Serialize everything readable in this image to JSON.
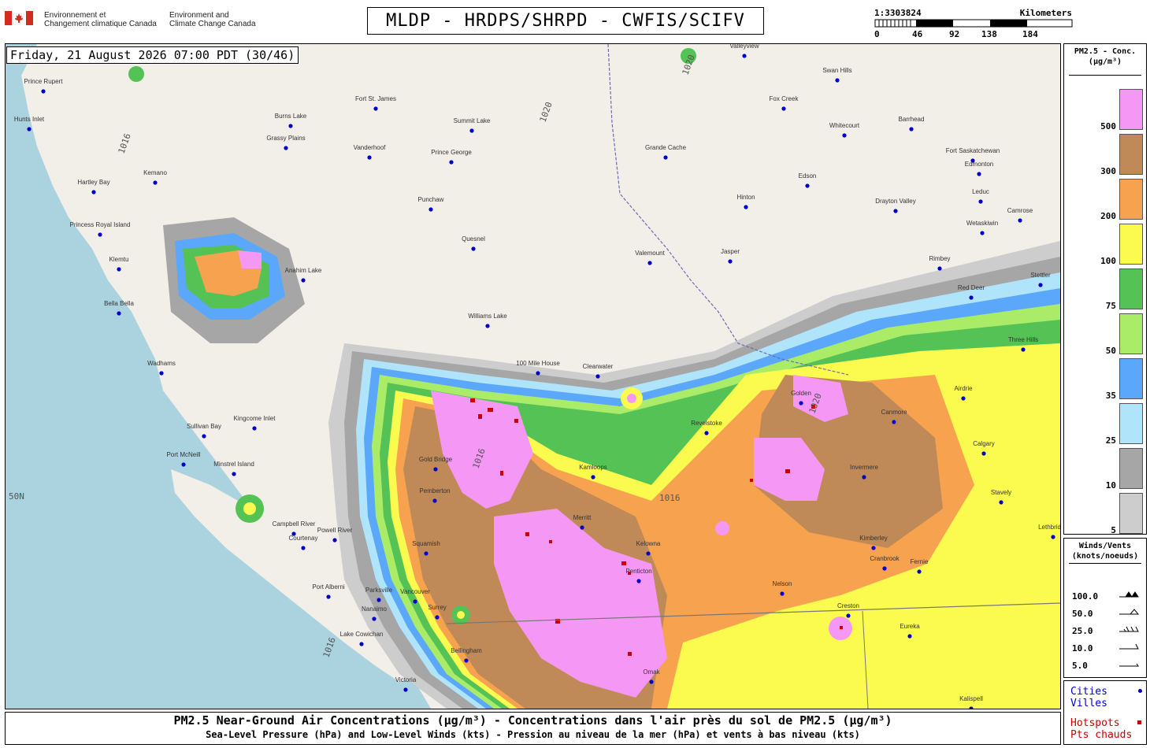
{
  "header": {
    "org_fr_line1": "Environnement et",
    "org_fr_line2": "Changement climatique Canada",
    "org_en_line1": "Environment and",
    "org_en_line2": "Climate Change Canada",
    "title": "MLDP - HRDPS/SHRPD - CWFIS/SCIFV"
  },
  "scale_bar": {
    "ratio": "1:3303824",
    "unit": "Kilometers",
    "ticks": [
      "0",
      "46",
      "92",
      "138",
      "184"
    ]
  },
  "map": {
    "timestamp": "Friday, 21 August 2026 07:00 PDT (30/46)",
    "latitude_label": "50N",
    "isobar_labels": [
      "1016",
      "1020"
    ],
    "cities": [
      {
        "name": "Prince Rupert"
      },
      {
        "name": "Hunts Inlet"
      },
      {
        "name": "Fort St. James"
      },
      {
        "name": "Burns Lake"
      },
      {
        "name": "Grassy Plains"
      },
      {
        "name": "Vanderhoof"
      },
      {
        "name": "Summit Lake"
      },
      {
        "name": "Prince George"
      },
      {
        "name": "Kemano"
      },
      {
        "name": "Hartley Bay"
      },
      {
        "name": "Princess Royal Island"
      },
      {
        "name": "Klemtu"
      },
      {
        "name": "Bella Bella"
      },
      {
        "name": "Anahim Lake"
      },
      {
        "name": "Punchaw"
      },
      {
        "name": "Quesnel"
      },
      {
        "name": "Williams Lake"
      },
      {
        "name": "100 Mile House"
      },
      {
        "name": "Wadhams"
      },
      {
        "name": "Kingcome Inlet"
      },
      {
        "name": "Sullivan Bay"
      },
      {
        "name": "Port McNeill"
      },
      {
        "name": "Minstrel Island"
      },
      {
        "name": "Campbell River"
      },
      {
        "name": "Powell River"
      },
      {
        "name": "Courtenay"
      },
      {
        "name": "Port Alberni"
      },
      {
        "name": "Parksville"
      },
      {
        "name": "Nanaimo"
      },
      {
        "name": "Lake Cowichan"
      },
      {
        "name": "Victoria"
      },
      {
        "name": "Vancouver"
      },
      {
        "name": "Surrey"
      },
      {
        "name": "Bellingham"
      },
      {
        "name": "Squamish"
      },
      {
        "name": "Gold Bridge"
      },
      {
        "name": "Pemberton"
      },
      {
        "name": "Kamloops"
      },
      {
        "name": "Clearwater"
      },
      {
        "name": "Merritt"
      },
      {
        "name": "Kelowna"
      },
      {
        "name": "Penticton"
      },
      {
        "name": "Omak"
      },
      {
        "name": "Grande Cache"
      },
      {
        "name": "Valemount"
      },
      {
        "name": "Jasper"
      },
      {
        "name": "Hinton"
      },
      {
        "name": "Edson"
      },
      {
        "name": "Whitecourt"
      },
      {
        "name": "Fox Creek"
      },
      {
        "name": "Swan Hills"
      },
      {
        "name": "Valleyview"
      },
      {
        "name": "Barrhead"
      },
      {
        "name": "Fort Saskatchewan"
      },
      {
        "name": "Edmonton"
      },
      {
        "name": "Leduc"
      },
      {
        "name": "Drayton Valley"
      },
      {
        "name": "Wetaskiwin"
      },
      {
        "name": "Camrose"
      },
      {
        "name": "Rimbey"
      },
      {
        "name": "Red Deer"
      },
      {
        "name": "Stettler"
      },
      {
        "name": "Three Hills"
      },
      {
        "name": "Airdrie"
      },
      {
        "name": "Calgary"
      },
      {
        "name": "Canmore"
      },
      {
        "name": "Golden"
      },
      {
        "name": "Revelstoke"
      },
      {
        "name": "Invermere"
      },
      {
        "name": "Kimberley"
      },
      {
        "name": "Cranbrook"
      },
      {
        "name": "Fernie"
      },
      {
        "name": "Nelson"
      },
      {
        "name": "Creston"
      },
      {
        "name": "Eureka"
      },
      {
        "name": "Kalispell"
      },
      {
        "name": "Stavely"
      },
      {
        "name": "Lethbridge"
      }
    ]
  },
  "legend": {
    "title_line1": "PM2.5 - Conc.",
    "title_line2": "(µg/m³)",
    "levels": [
      {
        "label": "500",
        "color": "#f598f5"
      },
      {
        "label": "300",
        "color": "#c08a58"
      },
      {
        "label": "200",
        "color": "#f7a24e"
      },
      {
        "label": "100",
        "color": "#fbfb4f"
      },
      {
        "label": "75",
        "color": "#54c254"
      },
      {
        "label": "50",
        "color": "#aaec68"
      },
      {
        "label": "35",
        "color": "#5aa7fb"
      },
      {
        "label": "25",
        "color": "#b0e4fb"
      },
      {
        "label": "10",
        "color": "#a6a6a6"
      },
      {
        "label": "5",
        "color": "#cdcdcd"
      }
    ]
  },
  "winds_legend": {
    "title_line1": "Winds/Vents",
    "title_line2": "(knots/noeuds)",
    "rows": [
      "100.0",
      "50.0",
      "25.0",
      "10.0",
      "5.0"
    ]
  },
  "markers_legend": {
    "cities_line1": "Cities",
    "cities_line2": "Villes",
    "cities_color": "#0000cc",
    "hotspots_line1": "Hotspots",
    "hotspots_line2": "Pts chauds",
    "hotspots_color": "#cc0000"
  },
  "footer": {
    "line1": "PM2.5 Near-Ground Air Concentrations (µg/m³) - Concentrations dans l'air près du sol de PM2.5 (µg/m³)",
    "line2": "Sea-Level Pressure (hPa) and Low-Level Winds (kts) - Pression au niveau de la mer (hPa) et vents à bas niveau (kts)"
  }
}
